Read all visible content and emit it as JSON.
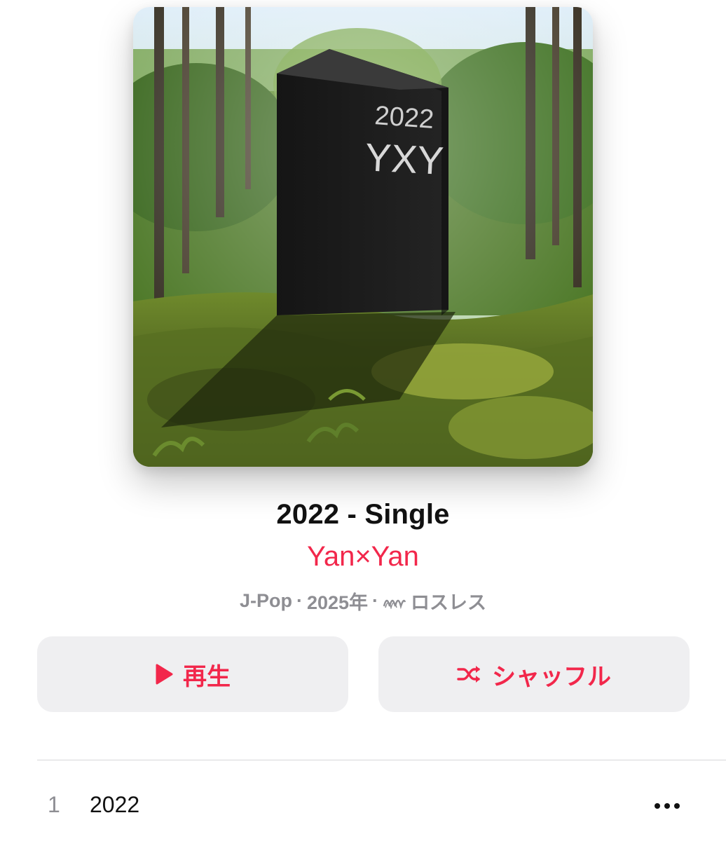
{
  "album": {
    "artwork_text_year": "2022",
    "artwork_text_name": "YXY",
    "title": "2022 - Single",
    "artist": "Yan×Yan",
    "genre": "J-Pop",
    "separator": "·",
    "year": "2025年",
    "quality_label": "ロスレス"
  },
  "actions": {
    "play_label": "再生",
    "shuffle_label": "シャッフル"
  },
  "tracks": [
    {
      "number": "1",
      "title": "2022"
    }
  ],
  "colors": {
    "accent": "#f2274b",
    "secondary_text": "#8e8e93",
    "button_bg": "#efeff1"
  },
  "icons": {
    "play": "play-icon",
    "shuffle": "shuffle-icon",
    "lossless": "lossless-icon",
    "more": "more-icon"
  }
}
